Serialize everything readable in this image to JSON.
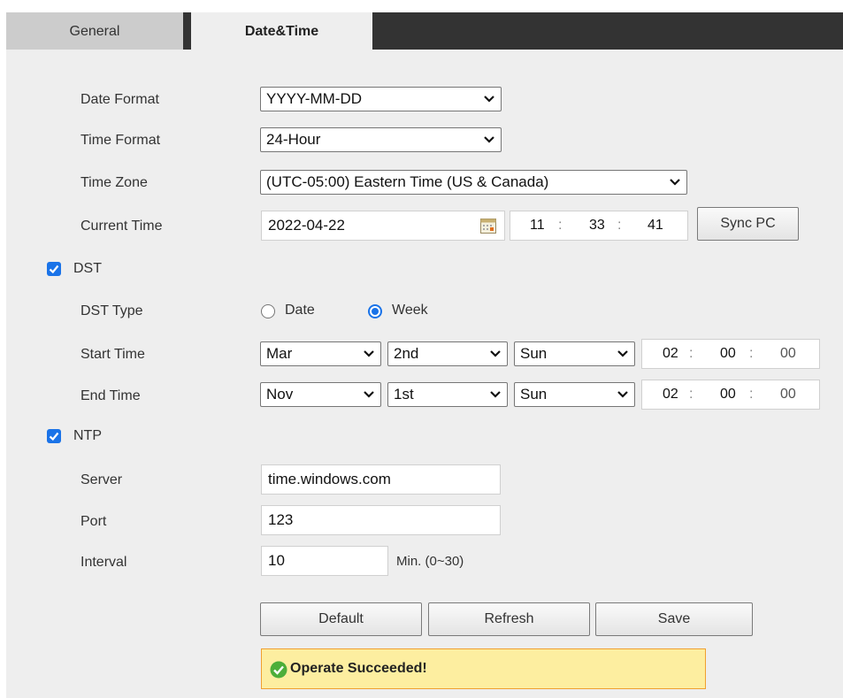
{
  "tabs": [
    {
      "label": "General",
      "active": false
    },
    {
      "label": "Date&Time",
      "active": true
    }
  ],
  "date_format": {
    "label": "Date Format",
    "value": "YYYY-MM-DD"
  },
  "time_format": {
    "label": "Time Format",
    "value": "24-Hour"
  },
  "time_zone": {
    "label": "Time Zone",
    "value": "(UTC-05:00) Eastern Time (US & Canada)"
  },
  "current_time": {
    "label": "Current Time",
    "date": "2022-04-22",
    "hh": "11",
    "mm": "33",
    "ss": "41",
    "sync_label": "Sync PC"
  },
  "dst": {
    "label": "DST",
    "checked": true,
    "type_label": "DST Type",
    "type_options": [
      "Date",
      "Week"
    ],
    "type_selected": "Week",
    "start": {
      "label": "Start Time",
      "month": "Mar",
      "week": "2nd",
      "day": "Sun",
      "hh": "02",
      "mm": "00",
      "ss": "00"
    },
    "end": {
      "label": "End Time",
      "month": "Nov",
      "week": "1st",
      "day": "Sun",
      "hh": "02",
      "mm": "00",
      "ss": "00"
    }
  },
  "ntp": {
    "label": "NTP",
    "checked": true,
    "server_label": "Server",
    "server": "time.windows.com",
    "port_label": "Port",
    "port": "123",
    "interval_label": "Interval",
    "interval": "10",
    "interval_unit": "Min. (0~30)"
  },
  "buttons": {
    "default": "Default",
    "refresh": "Refresh",
    "save": "Save"
  },
  "status": {
    "message": "Operate Succeeded!",
    "color": "#fdeea0",
    "icon": "success-check-icon"
  },
  "colors": {
    "accent": "#1a73e8",
    "tabbar": "#333333",
    "panel": "#eeeeee"
  }
}
